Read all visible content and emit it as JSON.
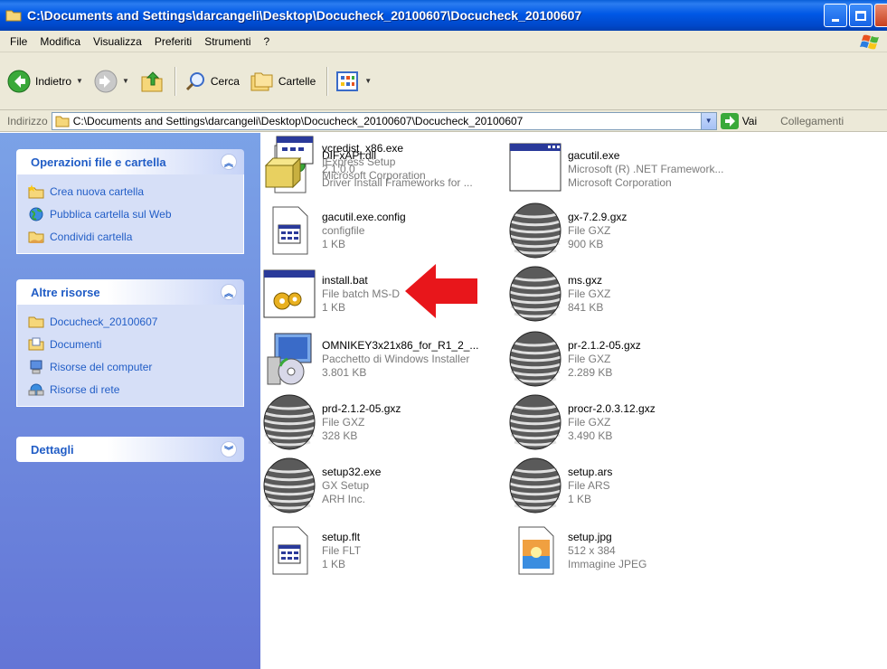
{
  "window": {
    "title": "C:\\Documents and Settings\\darcangeli\\Desktop\\Docucheck_20100607\\Docucheck_20100607"
  },
  "menu": [
    "File",
    "Modifica",
    "Visualizza",
    "Preferiti",
    "Strumenti",
    "?"
  ],
  "toolbar": {
    "back_label": "Indietro",
    "search_label": "Cerca",
    "folders_label": "Cartelle"
  },
  "address": {
    "label": "Indirizzo",
    "value": "C:\\Documents and Settings\\darcangeli\\Desktop\\Docucheck_20100607\\Docucheck_20100607",
    "go_label": "Vai",
    "links_label": "Collegamenti"
  },
  "tasks": {
    "file_folder": {
      "title": "Operazioni file e cartella",
      "items": [
        "Crea nuova cartella",
        "Pubblica cartella sul Web",
        "Condividi cartella"
      ]
    },
    "other": {
      "title": "Altre risorse",
      "items": [
        "Docucheck_20100607",
        "Documenti",
        "Risorse del computer",
        "Risorse di rete"
      ]
    },
    "details": {
      "title": "Dettagli"
    }
  },
  "files": [
    {
      "name": "DIFxAPI.dll",
      "line2": "2.1.0.0",
      "line3": "Driver Install Frameworks for ...",
      "icon": "dll-gear-icon"
    },
    {
      "name": "gacutil.exe",
      "line2": "Microsoft (R) .NET Framework...",
      "line3": "Microsoft Corporation",
      "icon": "exe-window-icon"
    },
    {
      "name": "gacutil.exe.config",
      "line2": "configfile",
      "line3": "1 KB",
      "icon": "config-file-icon"
    },
    {
      "name": "gx-7.2.9.gxz",
      "line2": "File GXZ",
      "line3": "900 KB",
      "icon": "gxz-icon"
    },
    {
      "name": "install.bat",
      "line2": "File batch MS-D",
      "line3": "1 KB",
      "icon": "batch-file-icon"
    },
    {
      "name": "ms.gxz",
      "line2": "File GXZ",
      "line3": "841 KB",
      "icon": "gxz-icon"
    },
    {
      "name": "OMNIKEY3x21x86_for_R1_2_...",
      "line2": "Pacchetto di Windows Installer",
      "line3": "3.801 KB",
      "icon": "installer-icon"
    },
    {
      "name": "pr-2.1.2-05.gxz",
      "line2": "File GXZ",
      "line3": "2.289 KB",
      "icon": "gxz-icon"
    },
    {
      "name": "prd-2.1.2-05.gxz",
      "line2": "File GXZ",
      "line3": "328 KB",
      "icon": "gxz-icon"
    },
    {
      "name": "procr-2.0.3.12.gxz",
      "line2": "File GXZ",
      "line3": "3.490 KB",
      "icon": "gxz-icon"
    },
    {
      "name": "setup32.exe",
      "line2": "GX Setup",
      "line3": "ARH Inc.",
      "icon": "gxz-icon"
    },
    {
      "name": "setup.ars",
      "line2": "File ARS",
      "line3": "1 KB",
      "icon": "gxz-icon"
    },
    {
      "name": "setup.flt",
      "line2": "File FLT",
      "line3": "1 KB",
      "icon": "config-file-icon"
    },
    {
      "name": "setup.jpg",
      "line2": "512 x 384",
      "line3": "Immagine JPEG",
      "icon": "jpeg-image-icon"
    },
    {
      "name": "vcredist_x86.exe",
      "line2": "IExpress Setup",
      "line3": "Microsoft Corporation",
      "icon": "iexpress-setup-icon"
    }
  ],
  "colors": {
    "title_bar": "#0058e6",
    "task_pane": "#6375d6",
    "task_link": "#215dc6",
    "highlight_arrow": "#e8161b"
  }
}
